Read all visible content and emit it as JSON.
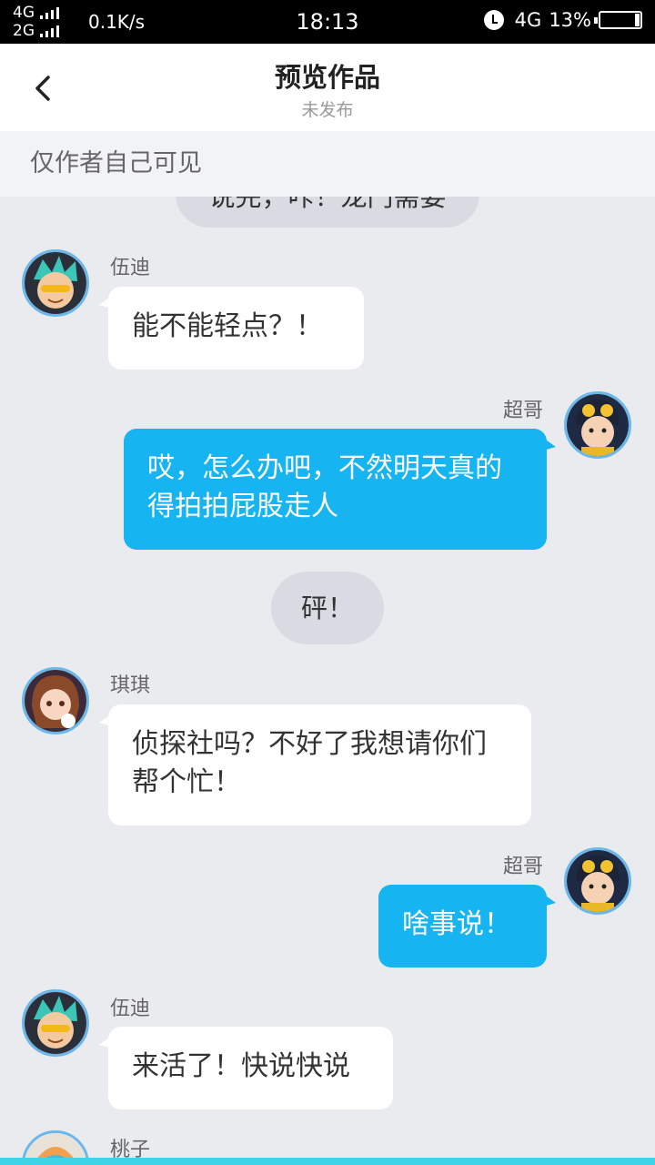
{
  "status_bar": {
    "network_top": "4G",
    "network_bottom": "2G",
    "speed": "0.1K/s",
    "time": "18:13",
    "network_right": "4G",
    "battery": "13%",
    "battery_level": 0.13
  },
  "header": {
    "title": "预览作品",
    "subtitle": "未发布"
  },
  "notice": "仅作者自己可见",
  "chat": {
    "partial_narration": "说完，咔！龙门需要",
    "messages": [
      {
        "speaker": "伍迪",
        "text": "能不能轻点？！",
        "side": "left"
      },
      {
        "speaker": "超哥",
        "text": "哎，怎么办吧，不然明天真的得拍拍屁股走人",
        "side": "right"
      },
      {
        "narration": "砰！"
      },
      {
        "speaker": "琪琪",
        "text": "侦探社吗？不好了我想请你们帮个忙！",
        "side": "left"
      },
      {
        "speaker": "超哥",
        "text": "啥事说！",
        "side": "right"
      },
      {
        "speaker": "伍迪",
        "text": "来活了！快说快说",
        "side": "left"
      },
      {
        "speaker": "桃子",
        "text": "",
        "side": "left"
      }
    ]
  },
  "colors": {
    "accent": "#16b4f0",
    "background": "#e9ebef",
    "avatar_ring": "#6ab8ea"
  }
}
